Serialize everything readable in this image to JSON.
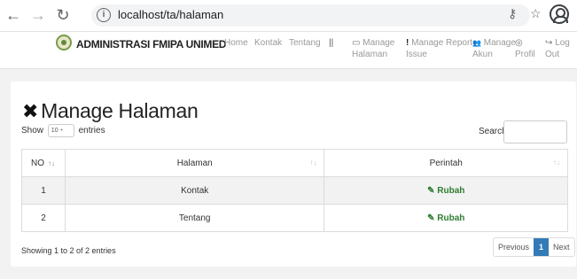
{
  "browser": {
    "back_icon": "arrow-left",
    "forward_icon": "arrow-right",
    "reload_icon": "reload",
    "info_icon": "info-circle",
    "url": "localhost/ta/halaman",
    "key_icon": "key",
    "star_icon": "star",
    "profile_icon": "account-circle"
  },
  "navbar": {
    "brand": "ADMINISTRASI FMIPA UNIMED",
    "items": [
      {
        "label": "Home",
        "icon": ""
      },
      {
        "label": "Kontak",
        "icon": ""
      },
      {
        "label": "Tentang",
        "icon": ""
      },
      {
        "label": "||",
        "icon": ""
      },
      {
        "label": "Manage",
        "label2": "Halaman",
        "icon": "▭"
      },
      {
        "label": "Manage Report",
        "label2": "Issue",
        "icon": "!"
      },
      {
        "label": "Manage",
        "label2": "Akun",
        "icon": "👥"
      },
      {
        "label": "",
        "label2": "Profil",
        "icon": "◎"
      },
      {
        "label": "Log",
        "label2": "Out",
        "icon": "↪"
      }
    ]
  },
  "page": {
    "title": "Manage Halaman",
    "title_icon": "✖",
    "show_prefix": "Show",
    "show_value": "10 ÷",
    "show_suffix": "entries",
    "search_label": "Search:"
  },
  "table": {
    "headers": [
      "NO",
      "Halaman",
      "Perintah"
    ],
    "rows": [
      {
        "no": "1",
        "halaman": "Kontak",
        "perintah": "Rubah"
      },
      {
        "no": "2",
        "halaman": "Tentang",
        "perintah": "Rubah"
      }
    ]
  },
  "footer": {
    "showing": "Showing 1 to 2 of 2 entries",
    "previous": "Previous",
    "current": "1",
    "next": "Next"
  }
}
